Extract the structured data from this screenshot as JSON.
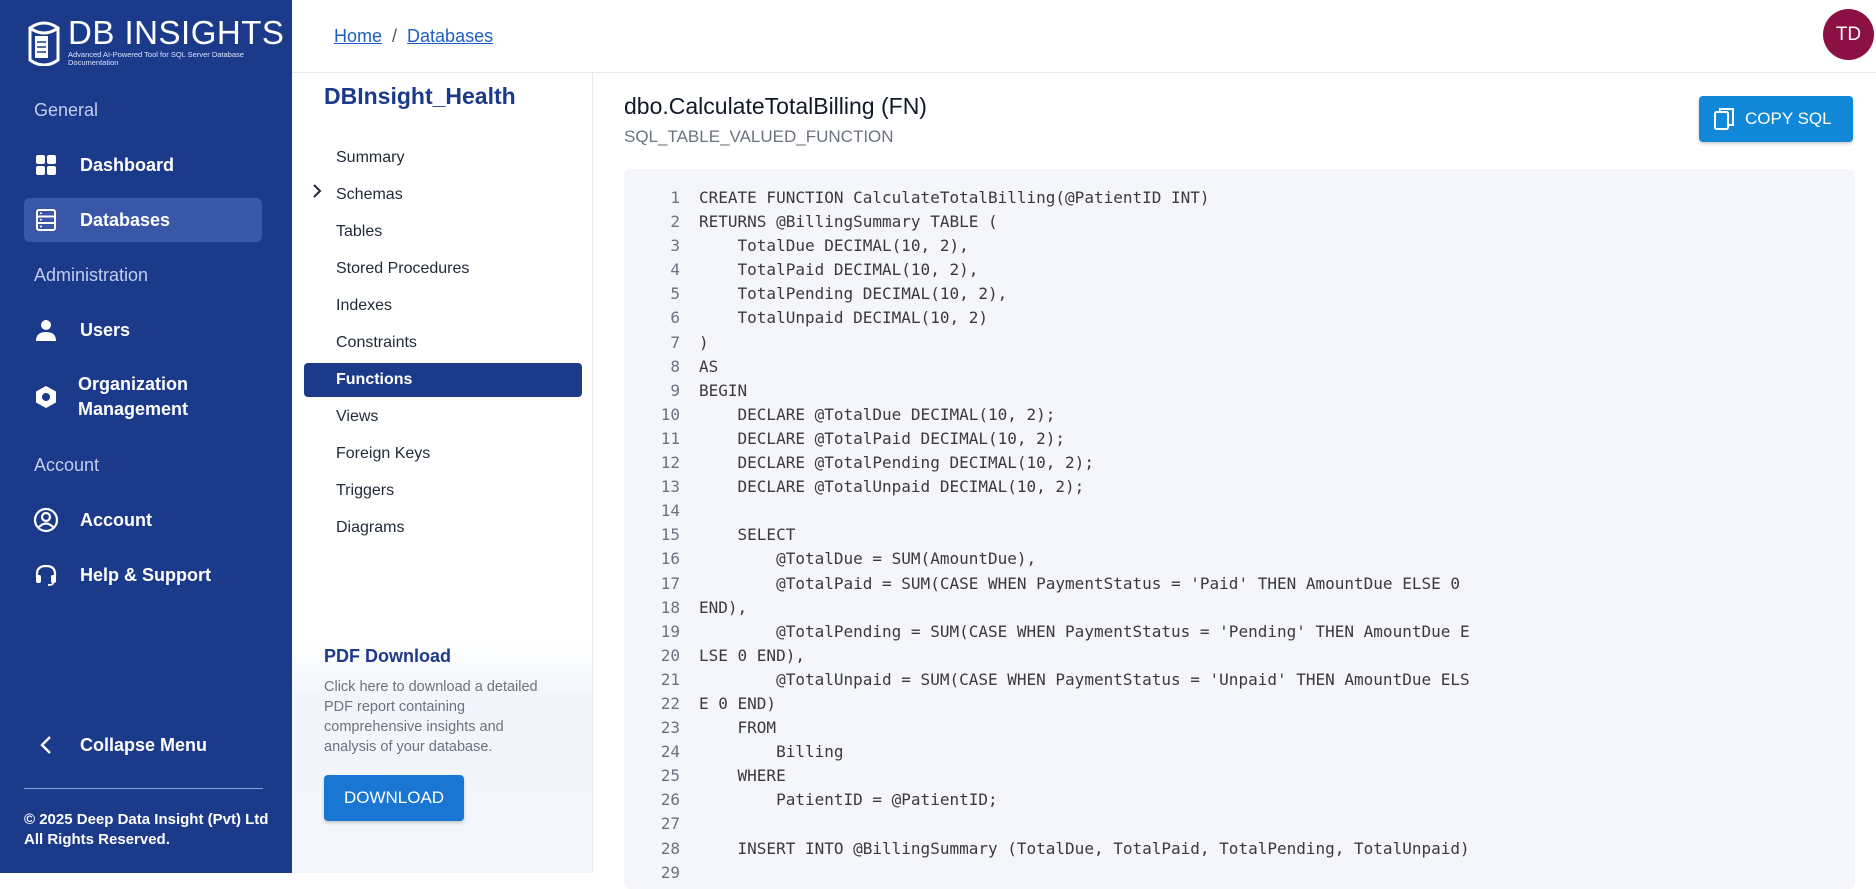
{
  "app": {
    "logo_title": "DB INSIGHTS",
    "logo_subtitle": "Advanced AI-Powered Tool for SQL Server Database Documentation",
    "brand_color": "#1c3a8a"
  },
  "sidebar": {
    "sections": [
      "General",
      "Administration",
      "Account"
    ],
    "items": [
      {
        "label": "Dashboard",
        "icon": "dashboard-icon"
      },
      {
        "label": "Databases",
        "icon": "database-icon",
        "active": true
      },
      {
        "label": "Users",
        "icon": "user-icon"
      },
      {
        "label": "Organization Management",
        "icon": "organization-icon"
      },
      {
        "label": "Account",
        "icon": "account-circle-icon"
      },
      {
        "label": "Help & Support",
        "icon": "headset-icon"
      }
    ],
    "collapse_label": "Collapse Menu",
    "copyright_line1": "© 2025 Deep Data Insight (Pvt) Ltd",
    "copyright_line2": "All Rights Reserved."
  },
  "header": {
    "breadcrumb": [
      "Home",
      "Databases"
    ],
    "avatar_initials": "TD",
    "avatar_color": "#8b1043"
  },
  "subnav": {
    "database_name": "DBInsight_Health",
    "items": [
      {
        "label": "Summary"
      },
      {
        "label": "Schemas",
        "expandable": true
      },
      {
        "label": "Tables"
      },
      {
        "label": "Stored Procedures"
      },
      {
        "label": "Indexes"
      },
      {
        "label": "Constraints"
      },
      {
        "label": "Functions",
        "active": true
      },
      {
        "label": "Views"
      },
      {
        "label": "Foreign Keys"
      },
      {
        "label": "Triggers"
      },
      {
        "label": "Diagrams"
      }
    ],
    "pdf": {
      "title": "PDF Download",
      "description": "Click here to download a detailed PDF report containing comprehensive insights and analysis of your database.",
      "button": "DOWNLOAD"
    }
  },
  "main": {
    "object_title": "dbo.CalculateTotalBilling (FN)",
    "object_type": "SQL_TABLE_VALUED_FUNCTION",
    "copy_button": "COPY SQL",
    "code_lines": [
      {
        "n": "1",
        "t": "CREATE FUNCTION CalculateTotalBilling(@PatientID INT)"
      },
      {
        "n": "2",
        "t": "RETURNS @BillingSummary TABLE ("
      },
      {
        "n": "3",
        "t": "    TotalDue DECIMAL(10, 2),"
      },
      {
        "n": "4",
        "t": "    TotalPaid DECIMAL(10, 2),"
      },
      {
        "n": "5",
        "t": "    TotalPending DECIMAL(10, 2),"
      },
      {
        "n": "6",
        "t": "    TotalUnpaid DECIMAL(10, 2)"
      },
      {
        "n": "7",
        "t": ")"
      },
      {
        "n": "8",
        "t": "AS"
      },
      {
        "n": "9",
        "t": "BEGIN"
      },
      {
        "n": "10",
        "t": "    DECLARE @TotalDue DECIMAL(10, 2);"
      },
      {
        "n": "11",
        "t": "    DECLARE @TotalPaid DECIMAL(10, 2);"
      },
      {
        "n": "12",
        "t": "    DECLARE @TotalPending DECIMAL(10, 2);"
      },
      {
        "n": "13",
        "t": "    DECLARE @TotalUnpaid DECIMAL(10, 2);"
      },
      {
        "n": "14",
        "t": ""
      },
      {
        "n": "15",
        "t": "    SELECT"
      },
      {
        "n": "16",
        "t": "        @TotalDue = SUM(AmountDue),"
      },
      {
        "n": "17",
        "t": "        @TotalPaid = SUM(CASE WHEN PaymentStatus = 'Paid' THEN AmountDue ELSE 0"
      },
      {
        "n": "18",
        "t": "END),"
      },
      {
        "n": "19",
        "t": "        @TotalPending = SUM(CASE WHEN PaymentStatus = 'Pending' THEN AmountDue E"
      },
      {
        "n": "20",
        "t": "LSE 0 END),"
      },
      {
        "n": "21",
        "t": "        @TotalUnpaid = SUM(CASE WHEN PaymentStatus = 'Unpaid' THEN AmountDue ELS"
      },
      {
        "n": "22",
        "t": "E 0 END)"
      },
      {
        "n": "23",
        "t": "    FROM"
      },
      {
        "n": "24",
        "t": "        Billing"
      },
      {
        "n": "25",
        "t": "    WHERE"
      },
      {
        "n": "26",
        "t": "        PatientID = @PatientID;"
      },
      {
        "n": "27",
        "t": ""
      },
      {
        "n": "28",
        "t": "    INSERT INTO @BillingSummary (TotalDue, TotalPaid, TotalPending, TotalUnpaid)"
      },
      {
        "n": "29",
        "t": ""
      }
    ]
  }
}
